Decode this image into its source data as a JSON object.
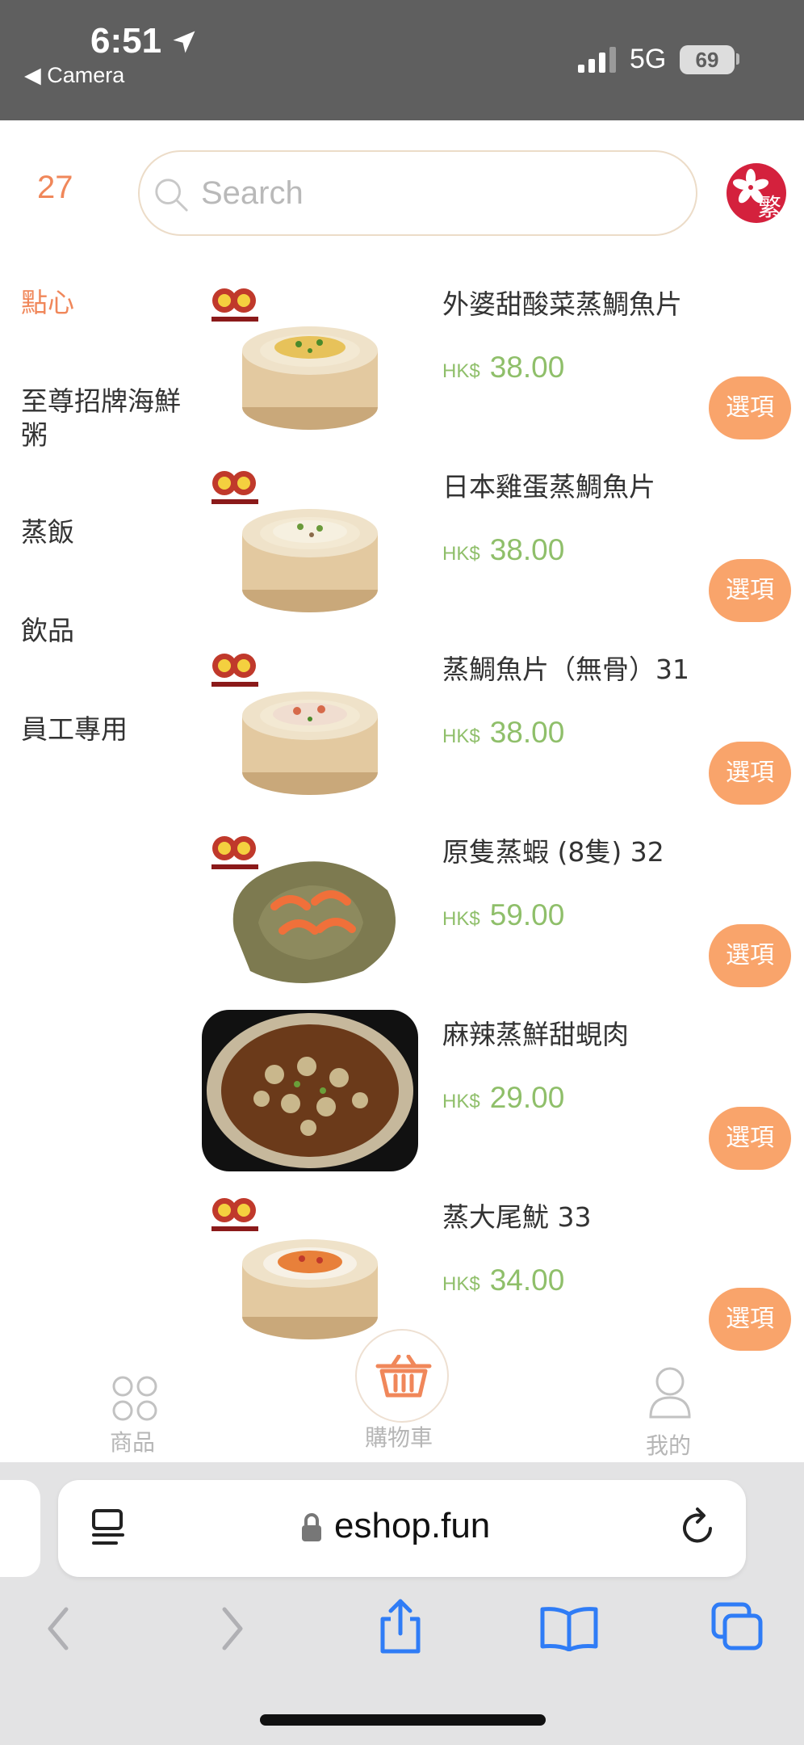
{
  "status_bar": {
    "time": "6:51",
    "back_app": "◀ Camera",
    "network": "5G",
    "battery": "69"
  },
  "header": {
    "cart_count": "27",
    "search_placeholder": "Search",
    "language_label": "繁"
  },
  "categories": [
    {
      "label": "點心",
      "active": true
    },
    {
      "label": "至尊招牌海鮮粥",
      "active": false
    },
    {
      "label": "蒸飯",
      "active": false
    },
    {
      "label": "飲品",
      "active": false
    },
    {
      "label": "員工專用",
      "active": false
    }
  ],
  "products": [
    {
      "name": "外婆甜酸菜蒸鯛魚片",
      "currency": "HK$",
      "price": "38.00",
      "option_label": "選項"
    },
    {
      "name": "日本雞蛋蒸鯛魚片",
      "currency": "HK$",
      "price": "38.00",
      "option_label": "選項"
    },
    {
      "name": "蒸鯛魚片（無骨）31",
      "currency": "HK$",
      "price": "38.00",
      "option_label": "選項"
    },
    {
      "name": "原隻蒸蝦 (8隻) 32",
      "currency": "HK$",
      "price": "59.00",
      "option_label": "選項"
    },
    {
      "name": "麻辣蒸鮮甜蜆肉",
      "currency": "HK$",
      "price": "29.00",
      "option_label": "選項"
    },
    {
      "name": "蒸大尾魷 33",
      "currency": "HK$",
      "price": "34.00",
      "option_label": "選項"
    }
  ],
  "tabbar": {
    "products": "商品",
    "cart": "購物車",
    "mine": "我的"
  },
  "browser": {
    "url": "eshop.fun"
  },
  "colors": {
    "accent": "#f0875a",
    "price": "#8fbf6a",
    "option_button": "#f9a46b",
    "status_bar": "#5f5f5f",
    "safari_icons": "#2f7cf6"
  }
}
